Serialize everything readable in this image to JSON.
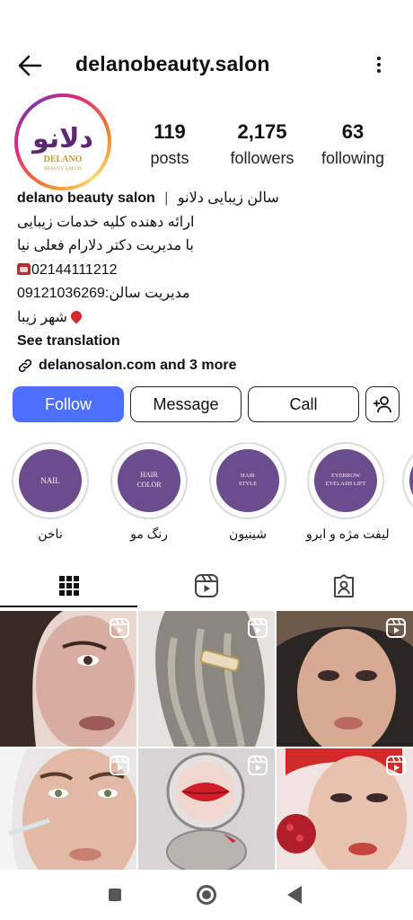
{
  "header": {
    "username": "delanobeauty.salon",
    "back_icon": "arrow-left-icon",
    "menu_icon": "more-vertical-icon"
  },
  "avatar": {
    "logo_text": "دلانو",
    "logo_name": "DELANO",
    "logo_sub": "BEAUTY SALON"
  },
  "stats": {
    "posts": {
      "value": "119",
      "label": "posts"
    },
    "followers": {
      "value": "2,175",
      "label": "followers"
    },
    "following": {
      "value": "63",
      "label": "following"
    }
  },
  "bio": {
    "name": "delano beauty salon",
    "name_fa": "سالن زیبایی دلانو",
    "line2": "ارائه دهنده کلیه خدمات زیبایی",
    "line3": "با مدیریت دکتر دلارام فعلی نیا",
    "phone": "02144111212",
    "manager_phone": "مدیریت سالن:09121036269",
    "location": "شهر زیبا",
    "see_translation": "See translation",
    "link": "delanosalon.com and 3 more"
  },
  "buttons": {
    "follow": "Follow",
    "message": "Message",
    "call": "Call"
  },
  "highlights": [
    {
      "title": [
        "NAIL"
      ],
      "label": "ناخن"
    },
    {
      "title": [
        "HAIR",
        "COLOR"
      ],
      "label": "رنگ مو"
    },
    {
      "title": [
        "HAIR",
        "STYLE"
      ],
      "label": "شینیون"
    },
    {
      "title": [
        "EYEBROW",
        "EYELASH LIFT"
      ],
      "label": "لیفت مژه و ابرو"
    }
  ],
  "tabs": [
    "grid-icon",
    "reels-icon",
    "tagged-icon"
  ],
  "colors": {
    "follow_button": "#4b6fff",
    "highlight_fill": "#6b4c8c",
    "text": "#111111"
  }
}
